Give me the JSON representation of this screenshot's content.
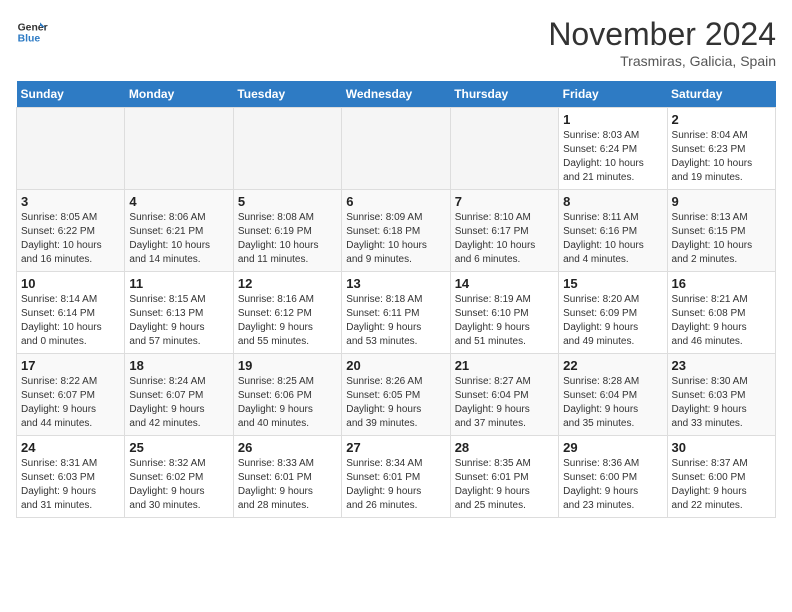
{
  "header": {
    "logo_line1": "General",
    "logo_line2": "Blue",
    "month": "November 2024",
    "location": "Trasmiras, Galicia, Spain"
  },
  "weekdays": [
    "Sunday",
    "Monday",
    "Tuesday",
    "Wednesday",
    "Thursday",
    "Friday",
    "Saturday"
  ],
  "weeks": [
    [
      {
        "day": "",
        "info": ""
      },
      {
        "day": "",
        "info": ""
      },
      {
        "day": "",
        "info": ""
      },
      {
        "day": "",
        "info": ""
      },
      {
        "day": "",
        "info": ""
      },
      {
        "day": "1",
        "info": "Sunrise: 8:03 AM\nSunset: 6:24 PM\nDaylight: 10 hours\nand 21 minutes."
      },
      {
        "day": "2",
        "info": "Sunrise: 8:04 AM\nSunset: 6:23 PM\nDaylight: 10 hours\nand 19 minutes."
      }
    ],
    [
      {
        "day": "3",
        "info": "Sunrise: 8:05 AM\nSunset: 6:22 PM\nDaylight: 10 hours\nand 16 minutes."
      },
      {
        "day": "4",
        "info": "Sunrise: 8:06 AM\nSunset: 6:21 PM\nDaylight: 10 hours\nand 14 minutes."
      },
      {
        "day": "5",
        "info": "Sunrise: 8:08 AM\nSunset: 6:19 PM\nDaylight: 10 hours\nand 11 minutes."
      },
      {
        "day": "6",
        "info": "Sunrise: 8:09 AM\nSunset: 6:18 PM\nDaylight: 10 hours\nand 9 minutes."
      },
      {
        "day": "7",
        "info": "Sunrise: 8:10 AM\nSunset: 6:17 PM\nDaylight: 10 hours\nand 6 minutes."
      },
      {
        "day": "8",
        "info": "Sunrise: 8:11 AM\nSunset: 6:16 PM\nDaylight: 10 hours\nand 4 minutes."
      },
      {
        "day": "9",
        "info": "Sunrise: 8:13 AM\nSunset: 6:15 PM\nDaylight: 10 hours\nand 2 minutes."
      }
    ],
    [
      {
        "day": "10",
        "info": "Sunrise: 8:14 AM\nSunset: 6:14 PM\nDaylight: 10 hours\nand 0 minutes."
      },
      {
        "day": "11",
        "info": "Sunrise: 8:15 AM\nSunset: 6:13 PM\nDaylight: 9 hours\nand 57 minutes."
      },
      {
        "day": "12",
        "info": "Sunrise: 8:16 AM\nSunset: 6:12 PM\nDaylight: 9 hours\nand 55 minutes."
      },
      {
        "day": "13",
        "info": "Sunrise: 8:18 AM\nSunset: 6:11 PM\nDaylight: 9 hours\nand 53 minutes."
      },
      {
        "day": "14",
        "info": "Sunrise: 8:19 AM\nSunset: 6:10 PM\nDaylight: 9 hours\nand 51 minutes."
      },
      {
        "day": "15",
        "info": "Sunrise: 8:20 AM\nSunset: 6:09 PM\nDaylight: 9 hours\nand 49 minutes."
      },
      {
        "day": "16",
        "info": "Sunrise: 8:21 AM\nSunset: 6:08 PM\nDaylight: 9 hours\nand 46 minutes."
      }
    ],
    [
      {
        "day": "17",
        "info": "Sunrise: 8:22 AM\nSunset: 6:07 PM\nDaylight: 9 hours\nand 44 minutes."
      },
      {
        "day": "18",
        "info": "Sunrise: 8:24 AM\nSunset: 6:07 PM\nDaylight: 9 hours\nand 42 minutes."
      },
      {
        "day": "19",
        "info": "Sunrise: 8:25 AM\nSunset: 6:06 PM\nDaylight: 9 hours\nand 40 minutes."
      },
      {
        "day": "20",
        "info": "Sunrise: 8:26 AM\nSunset: 6:05 PM\nDaylight: 9 hours\nand 39 minutes."
      },
      {
        "day": "21",
        "info": "Sunrise: 8:27 AM\nSunset: 6:04 PM\nDaylight: 9 hours\nand 37 minutes."
      },
      {
        "day": "22",
        "info": "Sunrise: 8:28 AM\nSunset: 6:04 PM\nDaylight: 9 hours\nand 35 minutes."
      },
      {
        "day": "23",
        "info": "Sunrise: 8:30 AM\nSunset: 6:03 PM\nDaylight: 9 hours\nand 33 minutes."
      }
    ],
    [
      {
        "day": "24",
        "info": "Sunrise: 8:31 AM\nSunset: 6:03 PM\nDaylight: 9 hours\nand 31 minutes."
      },
      {
        "day": "25",
        "info": "Sunrise: 8:32 AM\nSunset: 6:02 PM\nDaylight: 9 hours\nand 30 minutes."
      },
      {
        "day": "26",
        "info": "Sunrise: 8:33 AM\nSunset: 6:01 PM\nDaylight: 9 hours\nand 28 minutes."
      },
      {
        "day": "27",
        "info": "Sunrise: 8:34 AM\nSunset: 6:01 PM\nDaylight: 9 hours\nand 26 minutes."
      },
      {
        "day": "28",
        "info": "Sunrise: 8:35 AM\nSunset: 6:01 PM\nDaylight: 9 hours\nand 25 minutes."
      },
      {
        "day": "29",
        "info": "Sunrise: 8:36 AM\nSunset: 6:00 PM\nDaylight: 9 hours\nand 23 minutes."
      },
      {
        "day": "30",
        "info": "Sunrise: 8:37 AM\nSunset: 6:00 PM\nDaylight: 9 hours\nand 22 minutes."
      }
    ]
  ]
}
